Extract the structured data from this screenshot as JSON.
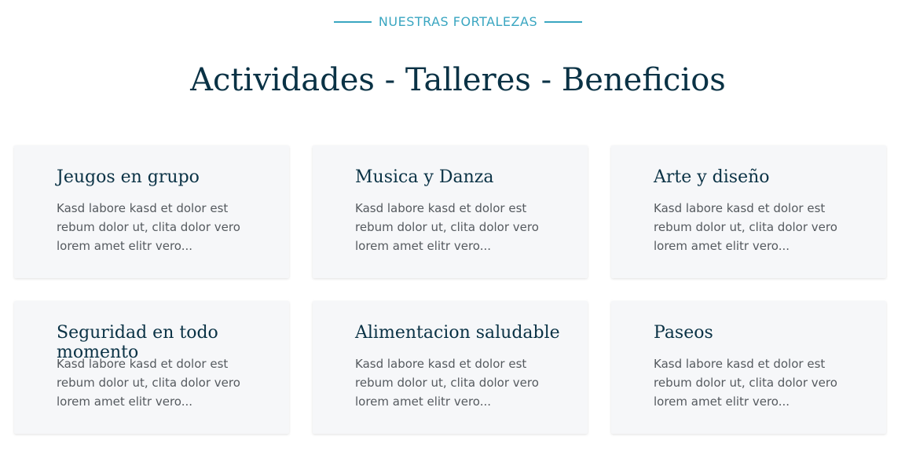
{
  "section": {
    "eyebrow": "NUESTRAS FORTALEZAS",
    "title": "Actividades - Talleres - Beneficios"
  },
  "cards": [
    {
      "title": "Jeugos en grupo",
      "text": "Kasd labore kasd et dolor est rebum dolor ut, clita dolor vero lorem amet elitr vero..."
    },
    {
      "title": "Musica y Danza",
      "text": "Kasd labore kasd et dolor est rebum dolor ut, clita dolor vero lorem amet elitr vero..."
    },
    {
      "title": "Arte y diseño",
      "text": "Kasd labore kasd et dolor est rebum dolor ut, clita dolor vero lorem amet elitr vero..."
    },
    {
      "title": "Seguridad en todo momento",
      "text": "Kasd labore kasd et dolor est rebum dolor ut, clita dolor vero lorem amet elitr vero..."
    },
    {
      "title": "Alimentacion saludable",
      "text": "Kasd labore kasd et dolor est rebum dolor ut, clita dolor vero lorem amet elitr vero..."
    },
    {
      "title": "Paseos",
      "text": "Kasd labore kasd et dolor est rebum dolor ut, clita dolor vero lorem amet elitr vero..."
    }
  ],
  "colors": {
    "accent": "#3aa6c1",
    "heading": "#0a3245",
    "card_bg": "#f6f7f9",
    "body_text": "#555a5f"
  }
}
